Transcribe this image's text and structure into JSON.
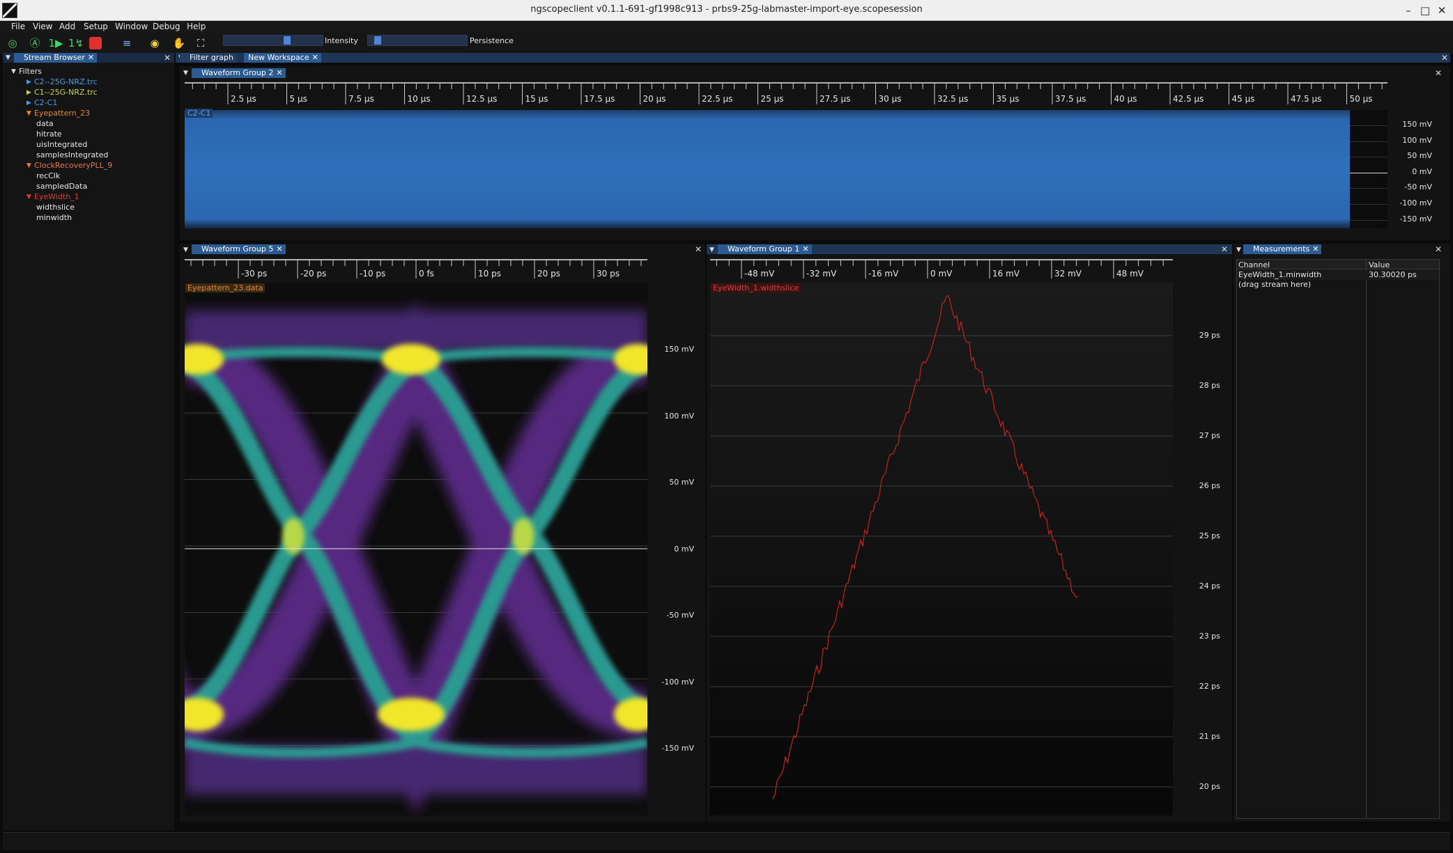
{
  "window": {
    "title": "ngscopeclient v0.1.1-691-gf1998c913  - prbs9-25g-labmaster-import-eye.scopesession"
  },
  "menu": [
    "File",
    "View",
    "Add",
    "Setup",
    "Window",
    "Debug",
    "Help"
  ],
  "toolbar": {
    "intensity_label": "Intensity",
    "persistence_label": "Persistence",
    "intensity_value": 0.65,
    "persistence_value": 0.05
  },
  "stream_browser": {
    "tab": "Stream Browser",
    "root": "Filters",
    "items": [
      {
        "label": "C2--25G-NRZ.trc",
        "color": "#4c9ce0",
        "level": 1,
        "expander": "▶"
      },
      {
        "label": "C1--25G-NRZ.trc",
        "color": "#c8d44a",
        "level": 1,
        "expander": "▶"
      },
      {
        "label": "C2-C1",
        "color": "#4c9ce0",
        "level": 1,
        "expander": "▶"
      },
      {
        "label": "Eyepattern_23",
        "color": "#e08a2c",
        "level": 1,
        "expander": "▼"
      },
      {
        "label": "data",
        "color": "#e6e6e6",
        "level": 2,
        "expander": ""
      },
      {
        "label": "hitrate",
        "color": "#e6e6e6",
        "level": 2,
        "expander": ""
      },
      {
        "label": "uisIntegrated",
        "color": "#e6e6e6",
        "level": 2,
        "expander": ""
      },
      {
        "label": "samplesIntegrated",
        "color": "#e6e6e6",
        "level": 2,
        "expander": ""
      },
      {
        "label": "ClockRecoveryPLL_9",
        "color": "#e07a4a",
        "level": 1,
        "expander": "▼"
      },
      {
        "label": "recClk",
        "color": "#e6e6e6",
        "level": 2,
        "expander": ""
      },
      {
        "label": "sampledData",
        "color": "#e6e6e6",
        "level": 2,
        "expander": ""
      },
      {
        "label": "EyeWidth_1",
        "color": "#e03a3a",
        "level": 1,
        "expander": "▼"
      },
      {
        "label": "widthslice",
        "color": "#e6e6e6",
        "level": 2,
        "expander": ""
      },
      {
        "label": "minwidth",
        "color": "#e6e6e6",
        "level": 2,
        "expander": ""
      }
    ]
  },
  "workspace_tabs": {
    "filter_graph": "Filter graph",
    "new_workspace": "New Workspace"
  },
  "group2": {
    "tab": "Waveform Group 2",
    "channel": "C2-C1",
    "x_ticks": [
      "2.5 µs",
      "5 µs",
      "7.5 µs",
      "10 µs",
      "12.5 µs",
      "15 µs",
      "17.5 µs",
      "20 µs",
      "22.5 µs",
      "25 µs",
      "27.5 µs",
      "30 µs",
      "32.5 µs",
      "35 µs",
      "37.5 µs",
      "40 µs",
      "42.5 µs",
      "45 µs",
      "47.5 µs",
      "50 µs"
    ],
    "y_ticks": [
      "150 mV",
      "100 mV",
      "50 mV",
      "0 mV",
      "-50 mV",
      "-100 mV",
      "-150 mV"
    ]
  },
  "group5": {
    "tab": "Waveform Group 5",
    "channel": "Eyepattern_23.data",
    "x_ticks": [
      "-30 ps",
      "-20 ps",
      "-10 ps",
      "0 fs",
      "10 ps",
      "20 ps",
      "30 ps"
    ],
    "y_ticks": [
      "150 mV",
      "100 mV",
      "50 mV",
      "0 mV",
      "-50 mV",
      "-100 mV",
      "-150 mV"
    ]
  },
  "group1": {
    "tab": "Waveform Group 1",
    "channel": "EyeWidth_1.widthslice",
    "x_ticks": [
      "-48 mV",
      "-32 mV",
      "-16 mV",
      "0 mV",
      "16 mV",
      "32 mV",
      "48 mV"
    ],
    "y_ticks": [
      "29 ps",
      "28 ps",
      "27 ps",
      "26 ps",
      "25 ps",
      "24 ps",
      "23 ps",
      "22 ps",
      "21 ps",
      "20 ps"
    ]
  },
  "measurements": {
    "tab": "Measurements",
    "headers": [
      "Channel",
      "Value"
    ],
    "rows": [
      [
        "EyeWidth_1.minwidth",
        "30.30020 ps"
      ],
      [
        "(drag stream here)",
        ""
      ]
    ]
  }
}
